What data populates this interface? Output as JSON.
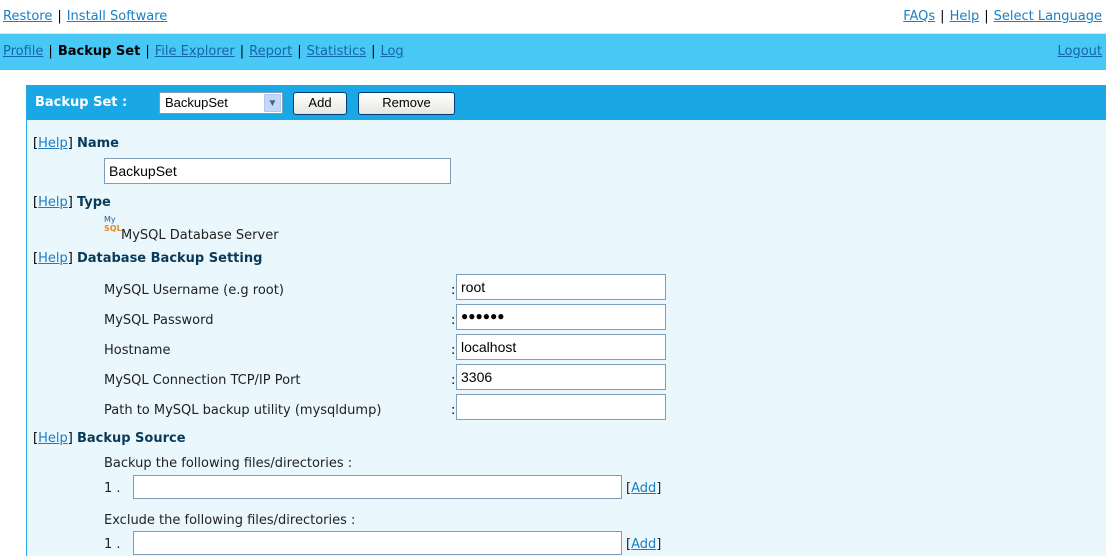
{
  "top_links": {
    "restore": "Restore",
    "install_software": "Install Software",
    "faqs": "FAQs",
    "help": "Help",
    "select_language": "Select Language",
    "separator": "|"
  },
  "nav": {
    "profile": "Profile",
    "backup_set": "Backup Set",
    "file_explorer": "File Explorer",
    "report": "Report",
    "statistics": "Statistics",
    "log": "Log",
    "logout": "Logout"
  },
  "panel": {
    "title": "Backup Set :",
    "selected_set": "BackupSet",
    "add_button": "Add",
    "remove_button": "Remove"
  },
  "help_link": "Help",
  "name_section": {
    "title": "Name",
    "value": "BackupSet"
  },
  "type_section": {
    "title": "Type",
    "icon_text_top": "My",
    "icon_text_bottom": "SQL",
    "value": "MySQL Database Server"
  },
  "db_section": {
    "title": "Database Backup Setting",
    "fields": [
      {
        "label": "MySQL Username (e.g root)",
        "value": "root"
      },
      {
        "label": "MySQL Password",
        "value": "●●●●●●"
      },
      {
        "label": "Hostname",
        "value": "localhost"
      },
      {
        "label": "MySQL Connection TCP/IP Port",
        "value": "3306"
      },
      {
        "label": "Path to MySQL backup utility (mysqldump)",
        "value": ""
      }
    ],
    "colon": ":"
  },
  "source_section": {
    "title": "Backup Source",
    "include_label": "Backup the following files/directories :",
    "exclude_label": "Exclude the following files/directories :",
    "row_number": "1 .",
    "include_value": "",
    "exclude_value": "",
    "add_link": "Add"
  },
  "colors": {
    "nav_bg": "#48c9f5",
    "panel_head_bg": "#1aa7e6",
    "panel_bg": "#eaf7fc",
    "link": "#1a7fc4"
  }
}
